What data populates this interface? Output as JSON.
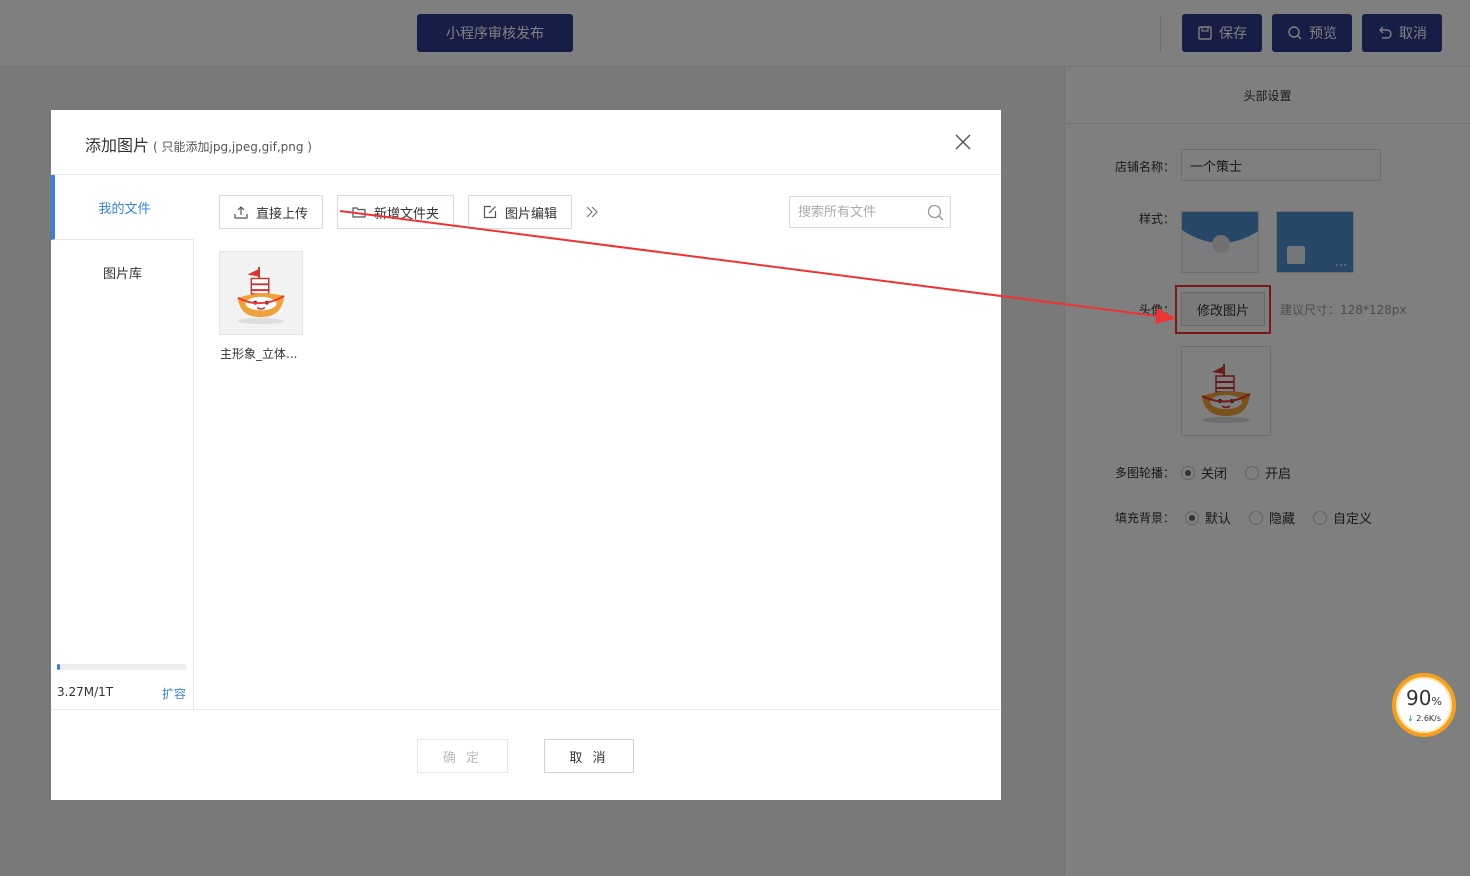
{
  "topbar": {
    "publish_label": "小程序审核发布",
    "save_label": "保存",
    "preview_label": "预览",
    "cancel_label": "取消"
  },
  "right_panel": {
    "title": "头部设置",
    "store_name_label": "店铺名称：",
    "store_name_value": "一个策士",
    "style_label": "样式：",
    "avatar_label": "头像：",
    "modify_image_label": "修改图片",
    "size_hint": "建议尺寸：128*128px",
    "carousel_label": "多图轮播：",
    "carousel_options": [
      "关闭",
      "开启"
    ],
    "carousel_selected": "关闭",
    "fill_bg_label": "填充背景：",
    "fill_bg_options": [
      "默认",
      "隐藏",
      "自定义"
    ],
    "fill_bg_selected": "默认"
  },
  "speed_widget": {
    "percent": "90",
    "percent_unit": "%",
    "rate": "2.6K/s"
  },
  "modal": {
    "title": "添加图片",
    "subtitle": "( 只能添加jpg,jpeg,gif,png )",
    "sidebar": {
      "items": [
        "我的文件",
        "图片库"
      ],
      "active": "我的文件",
      "storage_text": "3.27M/1T",
      "storage_fraction": 0.02,
      "expand_label": "扩容"
    },
    "toolbar": {
      "upload_label": "直接上传",
      "new_folder_label": "新增文件夹",
      "edit_image_label": "图片编辑",
      "search_placeholder": "搜索所有文件"
    },
    "files": [
      {
        "name": "主形象_立体..."
      }
    ],
    "footer": {
      "confirm_label": "确 定",
      "cancel_label": "取 消"
    }
  },
  "colors": {
    "brand_blue": "#2d3a8c",
    "link_blue": "#3b82d6",
    "highlight_red": "#e33333",
    "speed_orange": "#f4a21e"
  }
}
